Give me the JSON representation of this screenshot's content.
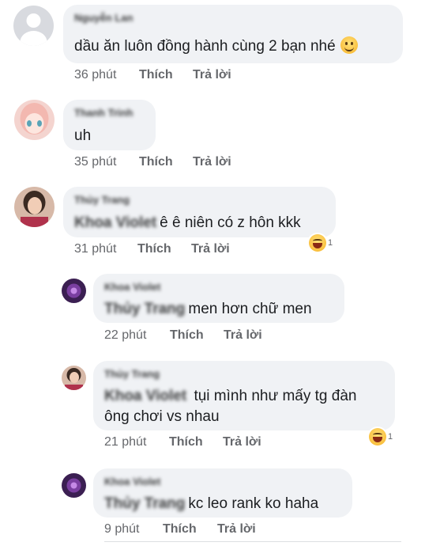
{
  "comments": [
    {
      "name": "Nguyễn Lan",
      "text": "dầu ăn luôn đồng hành cùng 2 bạn nhé",
      "emoji": "slight-smile-emoji",
      "time": "36 phút",
      "like": "Thích",
      "reply": "Trả lời"
    },
    {
      "name": "Thanh Trinh",
      "text": "uh",
      "time": "35 phút",
      "like": "Thích",
      "reply": "Trả lời"
    },
    {
      "name": "Thủy Trang",
      "tag": "Khoa Violet",
      "text": "ê ê niên có z hôn kkk",
      "time": "31 phút",
      "like": "Thích",
      "reply": "Trả lời",
      "reaction": {
        "icon": "haha-reaction-icon",
        "count": "1"
      }
    },
    {
      "name": "Khoa Violet",
      "tag": "Thủy Trang",
      "text": "men hơn chữ men",
      "time": "22 phút",
      "like": "Thích",
      "reply": "Trả lời"
    },
    {
      "name": "Thủy Trang",
      "tag": "Khoa Violet",
      "text_line1": "tụi mình như mấy tg đàn",
      "text_line2": "ông chơi vs nhau",
      "time": "21 phút",
      "like": "Thích",
      "reply": "Trả lời",
      "reaction": {
        "icon": "haha-reaction-icon",
        "count": "1"
      }
    },
    {
      "name": "Khoa Violet",
      "tag": "Thủy Trang",
      "text": "kc leo rank ko haha",
      "time": "9 phút",
      "like": "Thích",
      "reply": "Trả lời"
    }
  ]
}
